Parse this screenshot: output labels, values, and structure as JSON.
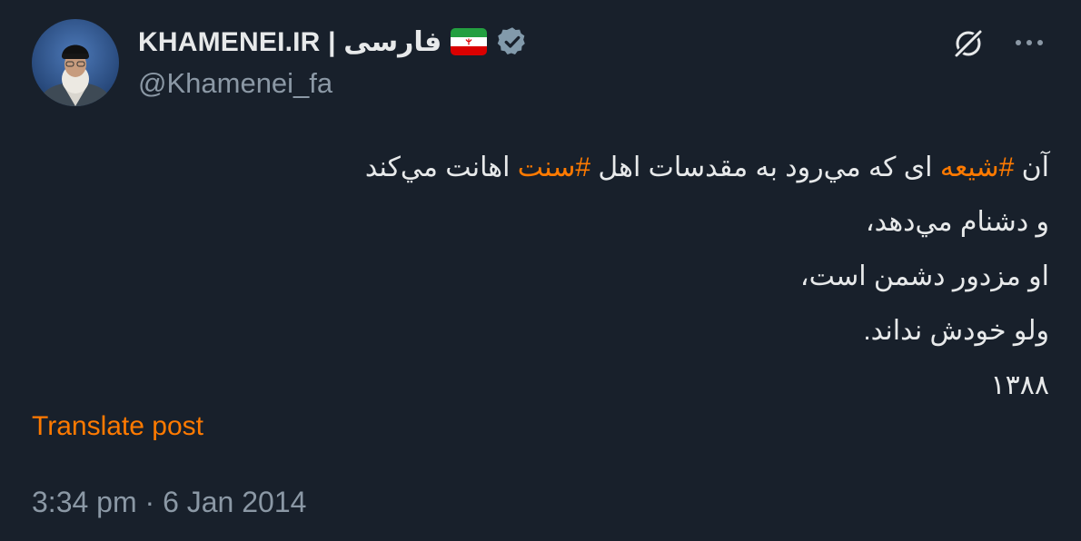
{
  "author": {
    "display_name": "KHAMENEI.IR | فارسی",
    "flag_icon": "iran-flag-icon",
    "verified_icon": "verified-badge-icon",
    "verified_color": "#829aab",
    "handle": "@Khamenei_fa",
    "avatar_icon": "profile-avatar"
  },
  "actions": {
    "grok_icon": "grok-icon",
    "more_icon": "more-options-icon"
  },
  "post": {
    "line1": {
      "part1": "آن ",
      "hashtag1": "#شیعه",
      "part2": " ای که مي‌رود به مقدسات اهل ",
      "hashtag2": "#سنت",
      "part3": " اهانت مي‌کند"
    },
    "line2": "و دشنام مي‌دهد،",
    "line3": "او مزدور دشمن است،",
    "line4": "ولو خودش نداند.",
    "line5": "۱۳۸۸"
  },
  "translate_label": "Translate post",
  "timestamp": "3:34 pm · 6 Jan 2014",
  "colors": {
    "background": "#18202b",
    "accent": "#ff7a00",
    "secondary_text": "#8b98a5",
    "primary_text": "#e7e9ea"
  }
}
